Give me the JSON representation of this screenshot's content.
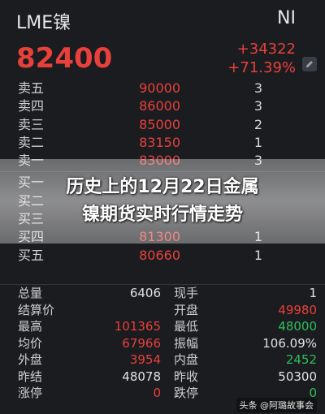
{
  "header": {
    "title": "LME镍",
    "symbol": "NI",
    "price": "82400",
    "change": "+34322",
    "change_pct": "+71.39%",
    "edit_icon": "pencil-icon"
  },
  "order_book": {
    "asks": [
      {
        "label": "卖五",
        "price": "90000",
        "volume": "3"
      },
      {
        "label": "卖四",
        "price": "86000",
        "volume": "3"
      },
      {
        "label": "卖三",
        "price": "85000",
        "volume": "2"
      },
      {
        "label": "卖二",
        "price": "83150",
        "volume": "1"
      },
      {
        "label": "卖一",
        "price": "83000",
        "volume": "3"
      }
    ],
    "bids": [
      {
        "label": "买一",
        "price": "",
        "volume": ""
      },
      {
        "label": "买二",
        "price": "",
        "volume": ""
      },
      {
        "label": "买三",
        "price": "",
        "volume": ""
      },
      {
        "label": "买四",
        "price": "81300",
        "volume": "1"
      },
      {
        "label": "买五",
        "price": "80660",
        "volume": "1"
      }
    ]
  },
  "overlay": {
    "line1": "历史上的12月22日金属",
    "line2": "镍期货实时行情走势"
  },
  "stats": [
    {
      "l1": "总量",
      "v1": "6406",
      "c1": "white",
      "l2": "现手",
      "v2": "1",
      "c2": "white"
    },
    {
      "l1": "结算价",
      "v1": "",
      "c1": "white",
      "l2": "开盘",
      "v2": "49980",
      "c2": "red"
    },
    {
      "l1": "最高",
      "v1": "101365",
      "c1": "red",
      "l2": "最低",
      "v2": "48000",
      "c2": "green"
    },
    {
      "l1": "均价",
      "v1": "67966",
      "c1": "red",
      "l2": "振幅",
      "v2": "106.09%",
      "c2": "white"
    },
    {
      "l1": "外盘",
      "v1": "3954",
      "c1": "red",
      "l2": "内盘",
      "v2": "2452",
      "c2": "green"
    },
    {
      "l1": "昨结",
      "v1": "48078",
      "c1": "white",
      "l2": "昨收",
      "v2": "50300",
      "c2": "white"
    },
    {
      "l1": "涨停",
      "v1": "0",
      "c1": "red",
      "l2": "跌停",
      "v2": "0",
      "c2": "green"
    }
  ],
  "watermark": "头条 @阿璐故事会"
}
